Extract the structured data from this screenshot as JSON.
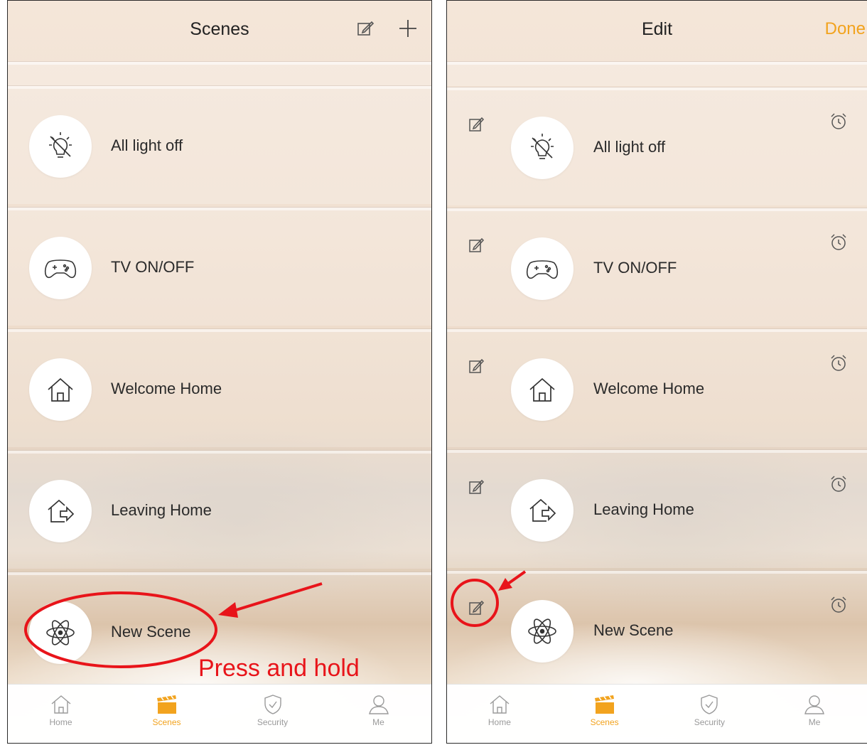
{
  "left": {
    "title": "Scenes",
    "scenes": [
      {
        "label": "All light off",
        "icon": "lightbulb-off-icon"
      },
      {
        "label": "TV ON/OFF",
        "icon": "gamepad-icon"
      },
      {
        "label": "Welcome Home",
        "icon": "house-icon"
      },
      {
        "label": "Leaving Home",
        "icon": "house-exit-icon"
      },
      {
        "label": "New Scene",
        "icon": "atom-icon"
      }
    ],
    "annotation": "Press and hold",
    "tabs": [
      {
        "label": "Home",
        "icon": "home-icon"
      },
      {
        "label": "Scenes",
        "icon": "clapperboard-icon",
        "active": true
      },
      {
        "label": "Security",
        "icon": "shield-check-icon"
      },
      {
        "label": "Me",
        "icon": "person-icon"
      }
    ]
  },
  "right": {
    "title": "Edit",
    "done_label": "Done",
    "scenes": [
      {
        "label": "All light off",
        "icon": "lightbulb-off-icon"
      },
      {
        "label": "TV ON/OFF",
        "icon": "gamepad-icon"
      },
      {
        "label": "Welcome Home",
        "icon": "house-icon"
      },
      {
        "label": "Leaving Home",
        "icon": "house-exit-icon"
      },
      {
        "label": "New Scene",
        "icon": "atom-icon"
      }
    ],
    "tabs": [
      {
        "label": "Home",
        "icon": "home-icon"
      },
      {
        "label": "Scenes",
        "icon": "clapperboard-icon",
        "active": true
      },
      {
        "label": "Security",
        "icon": "shield-check-icon"
      },
      {
        "label": "Me",
        "icon": "person-icon"
      }
    ]
  },
  "colors": {
    "accent": "#f2a31e",
    "annotation": "#e8141a"
  }
}
